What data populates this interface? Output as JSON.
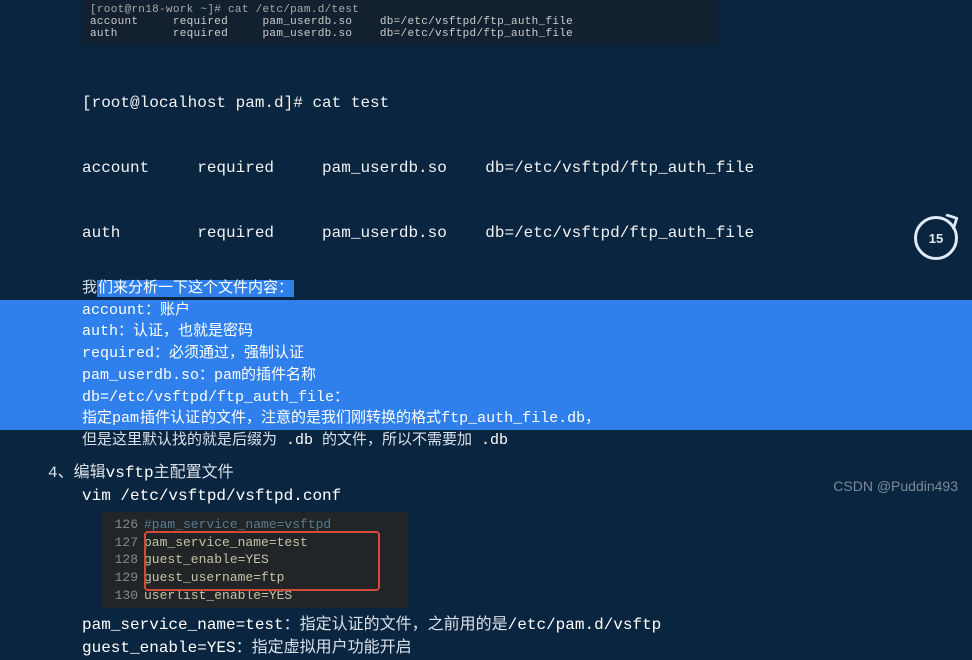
{
  "top_box": {
    "header": "[root@rn18-work ~]# cat /etc/pam.d/test",
    "row1": "account     required     pam_userdb.so    db=/etc/vsftpd/ftp_auth_file",
    "row2": "auth        required     pam_userdb.so    db=/etc/vsftpd/ftp_auth_file"
  },
  "term": {
    "prompt": "[root@localhost pam.d]# cat test",
    "row1": "account     required     pam_userdb.so    db=/etc/vsftpd/ftp_auth_file",
    "row2": "auth        required     pam_userdb.so    db=/etc/vsftpd/ftp_auth_file"
  },
  "analysis": {
    "pre": "我",
    "pre_hl": "们来分析一下这个文件内容：",
    "l2": "account：账户",
    "l3": "auth：认证，也就是密码",
    "l4": "required：必须通过，强制认证",
    "l5": "pam_userdb.so：pam的插件名称",
    "l6": "db=/etc/vsftpd/ftp_auth_file：",
    "l7a": "指定",
    "l7b": "pam",
    "l7c": "插件认证",
    "l7d": "的文件，注意的是我们刚转换的格式",
    "l7e": "ftp_auth_file.db",
    "l7f": "，",
    "l8a": "但是这里默认找的就是后缀为 ",
    "l8b": ".db",
    "l8c": " 的文件，所以不需要加 ",
    "l8d": ".db"
  },
  "section4": {
    "title_pre": "4、编辑",
    "title_code": "vsftp",
    "title_post": "主配置文件",
    "vim_pre": "vim ",
    "vim_path": "/etc/vsftpd/vsftpd.conf"
  },
  "code_box": {
    "lines": [
      {
        "ln": "126",
        "cls": "cmt",
        "txt": "#pam_service_name=vsftpd"
      },
      {
        "ln": "127",
        "cls": "kw",
        "txt": "pam_service_name=test"
      },
      {
        "ln": "128",
        "cls": "kw",
        "txt": "guest_enable=YES"
      },
      {
        "ln": "129",
        "cls": "kw",
        "txt": "guest_username=ftp"
      },
      {
        "ln": "130",
        "cls": "kw",
        "txt": "userlist_enable=YES"
      }
    ]
  },
  "footer": {
    "l1a": "pam_service_name=test",
    "l1b": "：指定认证的文件，之前用的是",
    "l1c": "/etc/pam.d/vsftp",
    "l2a": "guest_enable=YES",
    "l2b": "：指定虚拟用户功能开启"
  },
  "watermark": "CSDN @Puddin493",
  "badge": "15"
}
